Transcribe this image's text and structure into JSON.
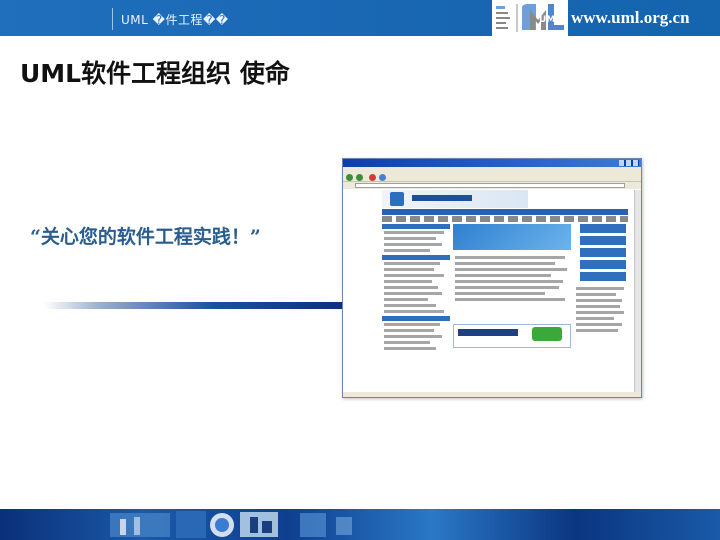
{
  "header": {
    "title": "UML �件工程��",
    "url": "www.uml.org.cn",
    "logo_text": "UML"
  },
  "main_title": "UML软件工程组织 使命",
  "slogan": "“关心您的软件工程实践！”",
  "colors": {
    "header_blue": "#1967b3",
    "slogan_blue": "#2a5d8f",
    "footer_blue": "#0b2f79"
  },
  "screenshot": {
    "description_icon": "browser-window-icon"
  }
}
